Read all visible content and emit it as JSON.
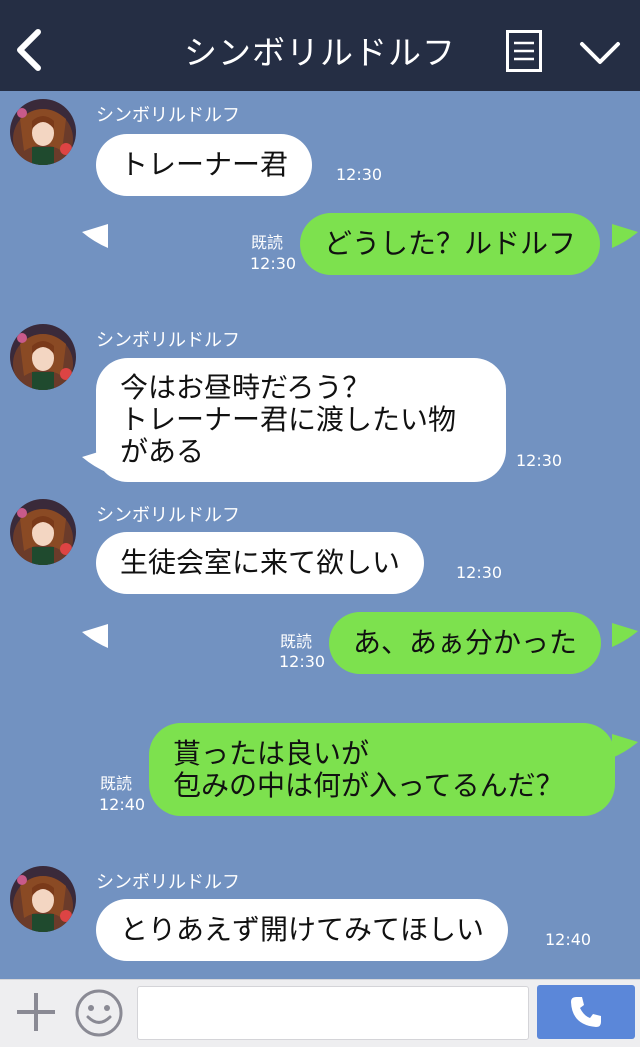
{
  "header": {
    "title": "シンボリルドルフ",
    "back_icon": "back-chevron-icon",
    "menu_icon": "menu-list-icon",
    "collapse_icon": "chevron-down-icon"
  },
  "colors": {
    "header_bg": "#252e44",
    "chat_bg": "#7292c1",
    "incoming_bubble": "#ffffff",
    "outgoing_bubble": "#7de14e",
    "send_button": "#5b87d9"
  },
  "messages": [
    {
      "direction": "in",
      "sender": "シンボリルドルフ",
      "text": "トレーナー君",
      "time": "12:30"
    },
    {
      "direction": "out",
      "read": "既読",
      "text": "どうした？ルドルフ",
      "time": "12:30"
    },
    {
      "direction": "in",
      "sender": "シンボリルドルフ",
      "text": "今はお昼時だろう？\nトレーナー君に渡したい物\nがある",
      "time": "12:30"
    },
    {
      "direction": "in",
      "sender": "シンボリルドルフ",
      "text": "生徒会室に来て欲しい",
      "time": "12:30"
    },
    {
      "direction": "out",
      "read": "既読",
      "text": "あ、あぁ分かった",
      "time": "12:30"
    },
    {
      "direction": "out",
      "read": "既読",
      "text": "貰ったは良いが\n包みの中は何が入ってるんだ？",
      "time": "12:40"
    },
    {
      "direction": "in",
      "sender": "シンボリルドルフ",
      "text": "とりあえず開けてみてほしい",
      "time": "12:40"
    }
  ],
  "input_bar": {
    "plus_icon": "plus-icon",
    "emoji_icon": "smiley-icon",
    "message_value": "",
    "call_icon": "phone-icon"
  }
}
